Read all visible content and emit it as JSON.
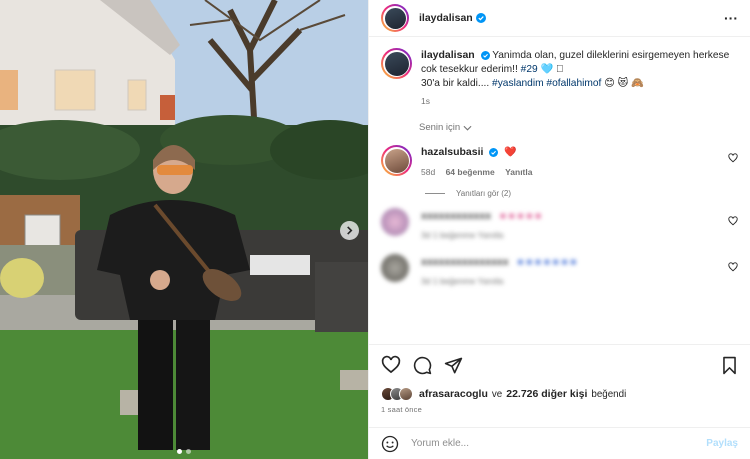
{
  "post": {
    "author": "ilaydalisan",
    "caption_line1": "Yanimda olan, guzel dileklerini esirgemeyen herkese cok tesekkur ederim!!",
    "caption_tag_29": "#29",
    "caption_emoji_1": "🩵 🏻",
    "caption_line2": "30'a bir kaldi....",
    "caption_tag_2": "#yaslandim",
    "caption_tag_3": "#ofallahimof",
    "caption_emoji_2": "😊 😻 🙈",
    "caption_time": "1s"
  },
  "filter_label": "Senin için",
  "top_comment": {
    "username": "hazalsubasii",
    "emoji": "❤️",
    "age": "58d",
    "likes": "64 beğenme",
    "reply": "Yanıtla",
    "view_replies": "Yanıtları gör (2)"
  },
  "blurred_comments": [
    {
      "username": "xxxxxxxxxxxx",
      "text": "■ ■ ■ ■ ■",
      "meta": "3d  1 beğenme  Yanıtla"
    },
    {
      "username": "xxxxxxxxxxxxxxx",
      "text": "■ ■ ■ ■ ■ ■ ■",
      "meta": "3d  1 beğenme  Yanıtla"
    }
  ],
  "likes": {
    "first_user": "afrasaracoglu",
    "connector": "ve",
    "others": "22.726 diğer kişi",
    "suffix": "beğendi"
  },
  "posted_ago": "1 saat önce",
  "comment_box": {
    "placeholder": "Yorum ekle...",
    "post_label": "Paylaş"
  },
  "icons": {
    "like": "heart-icon",
    "comment": "comment-icon",
    "share": "share-icon",
    "save": "bookmark-icon",
    "more": "more-icon",
    "emoji": "emoji-icon",
    "next": "chevron-right-icon"
  },
  "colors": {
    "verified": "#0095f6",
    "heart": "#ed4956",
    "link": "#00376b",
    "post_button": "#b2dffc"
  },
  "carousel": {
    "total": 2,
    "active": 1
  }
}
